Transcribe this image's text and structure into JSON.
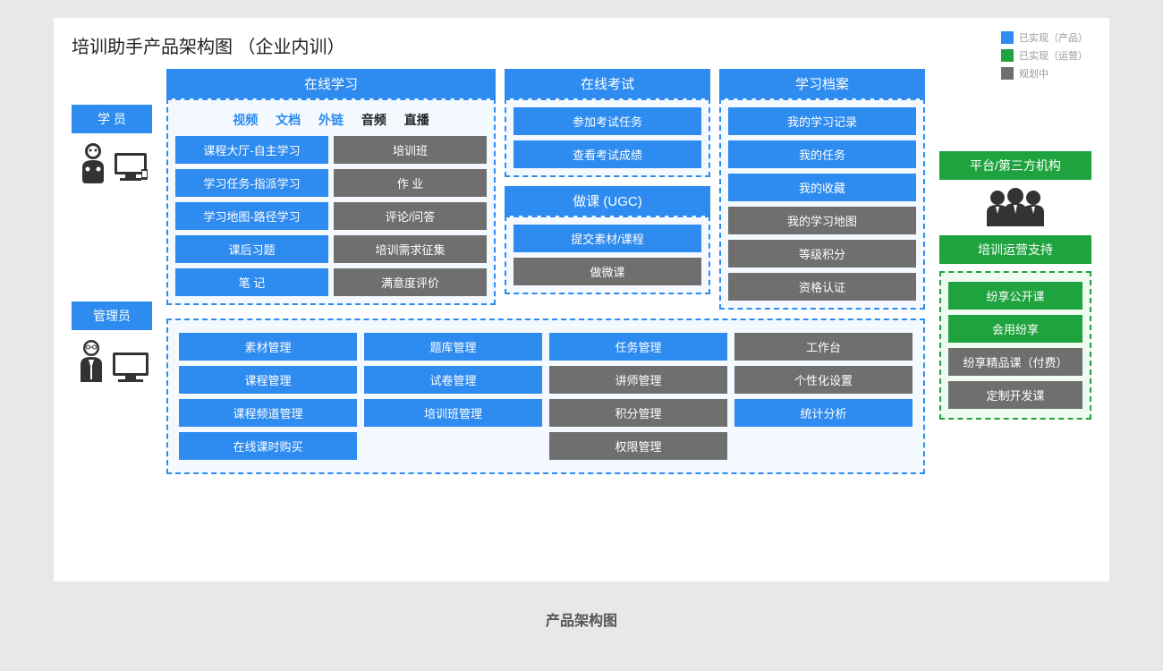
{
  "title": "培训助手产品架构图 （企业内训）",
  "caption": "产品架构图",
  "legend": {
    "l1": "已实现（产品）",
    "l2": "已实现（运营）",
    "l3": "规划中"
  },
  "roles": {
    "student": "学 员",
    "admin": "管理员"
  },
  "sec1": {
    "title": "在线学习",
    "tabs": {
      "t1": "视频",
      "t2": "文档",
      "t3": "外链",
      "t4": "音频",
      "t5": "直播"
    },
    "left": [
      "课程大厅-自主学习",
      "学习任务-指派学习",
      "学习地图-路径学习",
      "课后习题",
      "笔 记"
    ],
    "right": [
      "培训班",
      "作 业",
      "评论/问答",
      "培训需求征集",
      "满意度评价"
    ]
  },
  "sec2": {
    "t1": "在线考试",
    "a": [
      "参加考试任务",
      "查看考试成绩"
    ],
    "t2": "做课 (UGC)",
    "b": [
      "提交素材/课程",
      "做微课"
    ]
  },
  "sec3": {
    "title": "学习档案",
    "items": [
      "我的学习记录",
      "我的任务",
      "我的收藏",
      "我的学习地图",
      "等级积分",
      "资格认证"
    ]
  },
  "admin": {
    "c1": [
      "素材管理",
      "课程管理",
      "课程频道管理",
      "在线课时购买"
    ],
    "c2": [
      "题库管理",
      "试卷管理",
      "培训班管理"
    ],
    "c3": [
      "任务管理",
      "讲师管理",
      "积分管理",
      "权限管理"
    ],
    "c4": [
      "工作台",
      "个性化设置",
      "统计分析"
    ]
  },
  "right": {
    "h1": "平台/第三方机构",
    "h2": "培训运营支持",
    "items": [
      "纷享公开课",
      "会用纷享",
      "纷享精品课（付费）",
      "定制开发课"
    ]
  }
}
